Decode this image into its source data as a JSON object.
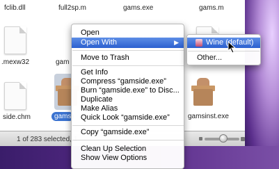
{
  "files_row1": [
    "fclib.dll",
    "full2sp.m",
    "gams.exe",
    "gams.m"
  ],
  "files_row2": [
    ".mexw32",
    "gam"
  ],
  "files_row3": [
    "side.chm",
    "gams",
    "gamsinst.exe"
  ],
  "status_text": "1 of 283 selected, 1",
  "context_menu": {
    "items": [
      "Open",
      "Open With",
      "Move to Trash",
      "Get Info",
      "Compress “gamside.exe”",
      "Burn “gamside.exe” to Disc...",
      "Duplicate",
      "Make Alias",
      "Quick Look “gamside.exe”",
      "Copy “gamside.exe”",
      "Clean Up Selection",
      "Show View Options"
    ]
  },
  "submenu": {
    "items": [
      "Wine (default)",
      "Other..."
    ]
  },
  "colors": {
    "highlight": "#2b5fcf",
    "desktop": "#5b2f8c"
  }
}
